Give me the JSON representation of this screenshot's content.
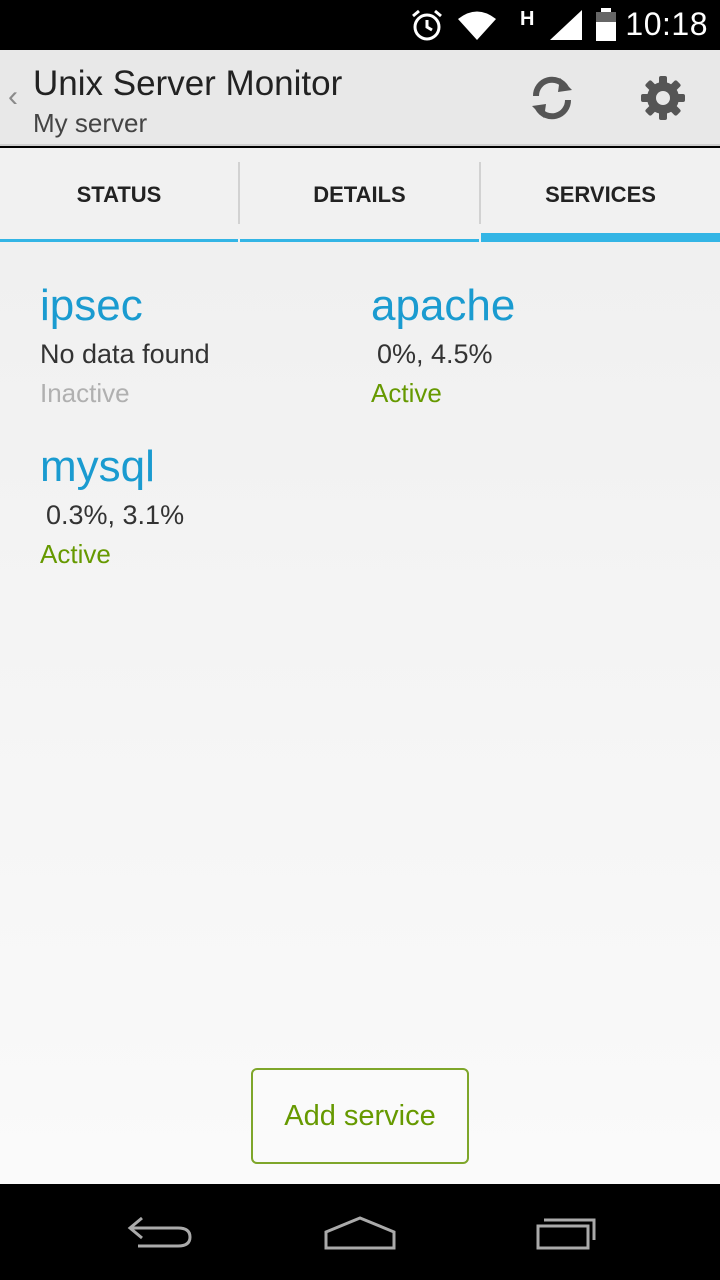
{
  "status_bar": {
    "time": "10:18",
    "network_type": "H",
    "icons": [
      "alarm-icon",
      "wifi-icon",
      "signal-icon",
      "battery-icon"
    ]
  },
  "action_bar": {
    "title": "Unix Server Monitor",
    "subtitle": "My server",
    "up_caret": "‹",
    "actions": [
      "refresh-icon",
      "settings-gear-icon"
    ]
  },
  "tabs": [
    {
      "label": "STATUS",
      "selected": false
    },
    {
      "label": "DETAILS",
      "selected": false
    },
    {
      "label": "SERVICES",
      "selected": true
    }
  ],
  "services": [
    {
      "name": "ipsec",
      "usage": "No data found",
      "status": "Inactive",
      "status_color": "#b0b0b0"
    },
    {
      "name": "apache",
      "usage": "0%,  4.5%",
      "status": "Active",
      "status_color": "#669900"
    },
    {
      "name": "mysql",
      "usage": "0.3%,  3.1%",
      "status": "Active",
      "status_color": "#669900"
    }
  ],
  "add_service_label": "Add service",
  "colors": {
    "accent": "#33b5e5",
    "service_name": "#1a9bd0",
    "active": "#669900",
    "inactive": "#b0b0b0"
  },
  "nav_bar": {
    "buttons": [
      "back-icon",
      "home-icon",
      "recent-apps-icon"
    ]
  }
}
